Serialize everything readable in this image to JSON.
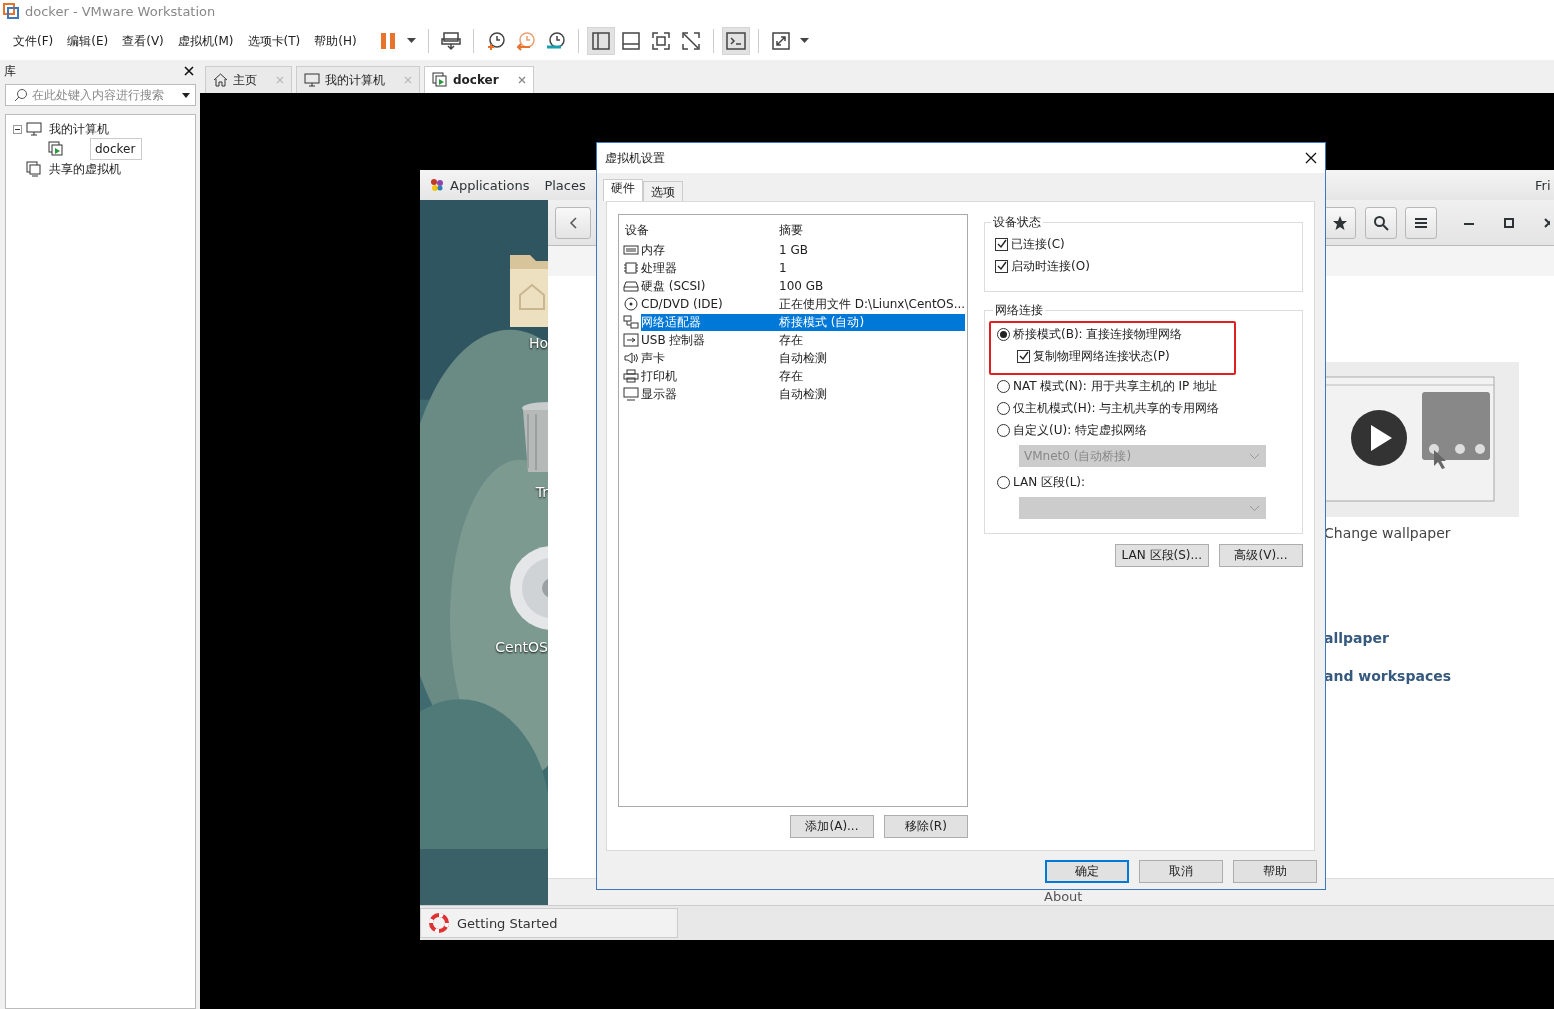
{
  "window": {
    "title": "docker - VMware Workstation"
  },
  "menu": [
    "文件(F)",
    "编辑(E)",
    "查看(V)",
    "虚拟机(M)",
    "选项卡(T)",
    "帮助(H)"
  ],
  "toolbar": [
    {
      "kind": "pause",
      "pressed": false
    },
    {
      "kind": "caret",
      "pressed": false
    },
    {
      "kind": "divider"
    },
    {
      "kind": "send",
      "pressed": false
    },
    {
      "kind": "divider"
    },
    {
      "kind": "snapshot",
      "pressed": false
    },
    {
      "kind": "revert",
      "pressed": false
    },
    {
      "kind": "manager",
      "pressed": false
    },
    {
      "kind": "divider"
    },
    {
      "kind": "sidebar",
      "pressed": true
    },
    {
      "kind": "thumbnail",
      "pressed": false
    },
    {
      "kind": "fullscreen",
      "pressed": false
    },
    {
      "kind": "unity",
      "pressed": false
    },
    {
      "kind": "divider"
    },
    {
      "kind": "console",
      "pressed": true
    },
    {
      "kind": "divider"
    },
    {
      "kind": "stretch",
      "pressed": false
    },
    {
      "kind": "caret",
      "pressed": false
    }
  ],
  "library": {
    "title": "库",
    "search": {
      "placeholder": "在此处键入内容进行搜索"
    },
    "tree": [
      {
        "kind": "computer",
        "label": "我的计算机",
        "expanded": true,
        "selected": false,
        "children": [
          {
            "kind": "vm",
            "label": "docker",
            "selected": true
          }
        ]
      },
      {
        "kind": "shared",
        "label": "共享的虚拟机",
        "selected": false
      }
    ]
  },
  "tabs": [
    {
      "kind": "home",
      "label": "主页",
      "selected": false
    },
    {
      "kind": "computer",
      "label": "我的计算机",
      "selected": false
    },
    {
      "kind": "vm",
      "label": "docker",
      "selected": true
    }
  ],
  "guest": {
    "topbar": {
      "items": [
        "Applications",
        "Places"
      ],
      "clock": "Fri"
    },
    "desktop_icons": [
      {
        "kind": "folder",
        "label": "Ho"
      },
      {
        "kind": "trash",
        "label": "Tr"
      },
      {
        "kind": "disc",
        "label": "CentOS"
      }
    ],
    "app_window": {
      "caption": "Change wallpaper",
      "links": [
        "allpaper",
        "and workspaces"
      ],
      "footer": "About"
    },
    "taskbar": {
      "label": "Getting Started"
    }
  },
  "dialog": {
    "title": "虚拟机设置",
    "tabs": [
      {
        "label": "硬件",
        "selected": true
      },
      {
        "label": "选项",
        "selected": false
      }
    ],
    "devices": {
      "columns": [
        "设备",
        "摘要"
      ],
      "rows": [
        {
          "kind": "memory",
          "name": "内存",
          "summary": "1 GB",
          "selected": false
        },
        {
          "kind": "cpu",
          "name": "处理器",
          "summary": "1",
          "selected": false
        },
        {
          "kind": "disk",
          "name": "硬盘 (SCSI)",
          "summary": "100 GB",
          "selected": false
        },
        {
          "kind": "cd",
          "name": "CD/DVD (IDE)",
          "summary": "正在使用文件 D:\\Liunx\\CentOS...",
          "selected": false
        },
        {
          "kind": "network",
          "name": "网络适配器",
          "summary": "桥接模式 (自动)",
          "selected": true
        },
        {
          "kind": "usb",
          "name": "USB 控制器",
          "summary": "存在",
          "selected": false
        },
        {
          "kind": "sound",
          "name": "声卡",
          "summary": "自动检测",
          "selected": false
        },
        {
          "kind": "printer",
          "name": "打印机",
          "summary": "存在",
          "selected": false
        },
        {
          "kind": "display",
          "name": "显示器",
          "summary": "自动检测",
          "selected": false
        }
      ]
    },
    "list_buttons": [
      "添加(A)...",
      "移除(R)"
    ],
    "device_status": {
      "title": "设备状态",
      "options": [
        {
          "label": "已连接(C)",
          "checked": true
        },
        {
          "label": "启动时连接(O)",
          "checked": true
        }
      ]
    },
    "network": {
      "title": "网络连接",
      "options": [
        {
          "kind": "radio",
          "label": "桥接模式(B): 直接连接物理网络",
          "selected": true,
          "highlighted": true
        },
        {
          "kind": "checkbox",
          "label": "复制物理网络连接状态(P)",
          "checked": true,
          "highlighted": true
        },
        {
          "kind": "radio",
          "label": "NAT 模式(N): 用于共享主机的 IP 地址",
          "selected": false
        },
        {
          "kind": "radio",
          "label": "仅主机模式(H): 与主机共享的专用网络",
          "selected": false
        },
        {
          "kind": "radio",
          "label": "自定义(U): 特定虚拟网络",
          "selected": false
        },
        {
          "kind": "select",
          "value": "VMnet0 (自动桥接)",
          "disabled": true
        },
        {
          "kind": "radio",
          "label": "LAN 区段(L):",
          "selected": false
        },
        {
          "kind": "select",
          "disabled": true
        }
      ]
    },
    "network_buttons": [
      "LAN 区段(S)...",
      "高级(V)..."
    ],
    "buttons": [
      {
        "label": "确定",
        "default": true
      },
      {
        "label": "取消",
        "default": false
      },
      {
        "label": "帮助",
        "default": false
      }
    ]
  }
}
